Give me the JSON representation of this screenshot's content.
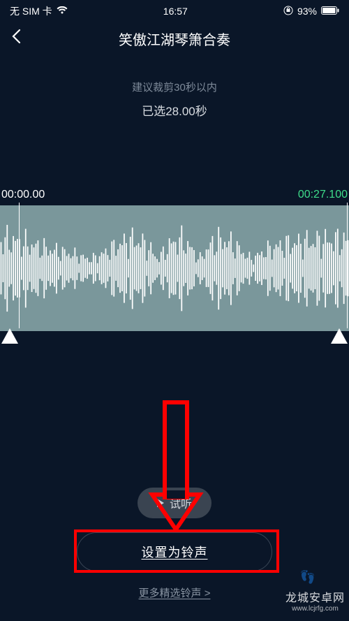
{
  "status": {
    "carrier": "无 SIM 卡",
    "time": "16:57",
    "battery": "93%"
  },
  "header": {
    "title": "笑傲江湖琴箫合奏"
  },
  "tips": {
    "hint": "建议裁剪30秒以内",
    "selected": "已选28.00秒"
  },
  "editor": {
    "start_time": "00:00.00",
    "end_time": "00:27.100"
  },
  "actions": {
    "preview_label": "试听",
    "set_ringtone_label": "设置为铃声",
    "more_label": "更多精选铃声 >"
  },
  "watermark": {
    "line1": "龙城安卓网",
    "line2": "www.lcjrfg.com"
  }
}
